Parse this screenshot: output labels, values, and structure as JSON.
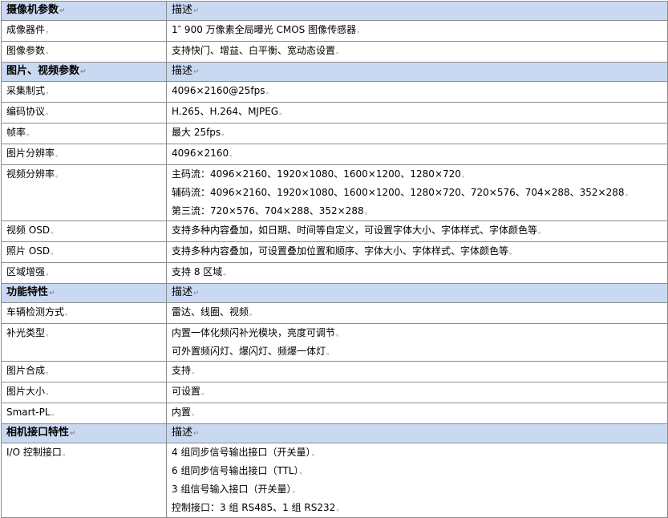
{
  "mark_label": "↵",
  "mark_cell": "。",
  "sections": [
    {
      "header": "摄像机参数",
      "desc": "描述",
      "rows": [
        {
          "name": "成像器件",
          "lines": [
            "1″ 900 万像素全局曝光 CMOS 图像传感器"
          ]
        },
        {
          "name": "图像参数",
          "lines": [
            "支持快门、增益、白平衡、宽动态设置"
          ]
        }
      ]
    },
    {
      "header": "图片、视频参数",
      "desc": "描述",
      "rows": [
        {
          "name": "采集制式",
          "lines": [
            "4096×2160@25fps"
          ]
        },
        {
          "name": "编码协议",
          "lines": [
            "H.265、H.264、MJPEG"
          ]
        },
        {
          "name": "帧率",
          "lines": [
            "最大 25fps"
          ]
        },
        {
          "name": "图片分辨率",
          "lines": [
            "4096×2160"
          ]
        },
        {
          "name": "视频分辨率",
          "lines": [
            "主码流：4096×2160、1920×1080、1600×1200、1280×720",
            "辅码流：4096×2160、1920×1080、1600×1200、1280×720、720×576、704×288、352×288",
            "第三流：720×576、704×288、352×288"
          ]
        },
        {
          "name": "视频 OSD",
          "lines": [
            "支持多种内容叠加，如日期、时间等自定义，可设置字体大小、字体样式、字体颜色等"
          ]
        },
        {
          "name": "照片 OSD",
          "lines": [
            "支持多种内容叠加，可设置叠加位置和顺序、字体大小、字体样式、字体颜色等"
          ]
        },
        {
          "name": "区域增强",
          "lines": [
            "支持 8 区域"
          ]
        }
      ]
    },
    {
      "header": "功能特性",
      "desc": "描述",
      "rows": [
        {
          "name": "车辆检测方式",
          "lines": [
            "雷达、线圈、视频"
          ]
        },
        {
          "name": "补光类型",
          "lines": [
            "内置一体化频闪补光模块，亮度可调节",
            "可外置频闪灯、爆闪灯、频爆一体灯"
          ]
        },
        {
          "name": "图片合成",
          "lines": [
            "支持"
          ]
        },
        {
          "name": "图片大小",
          "lines": [
            "可设置"
          ]
        },
        {
          "name": "Smart-PL",
          "lines": [
            "内置"
          ]
        }
      ]
    },
    {
      "header": "相机接口特性",
      "desc": "描述",
      "rows": [
        {
          "name": "I/O 控制接口",
          "lines": [
            "4 组同步信号输出接口（开关量）",
            "6 组同步信号输出接口（TTL）",
            "3 组信号输入接口（开关量）",
            "控制接口：3 组 RS485、1 组 RS232"
          ]
        }
      ]
    }
  ]
}
